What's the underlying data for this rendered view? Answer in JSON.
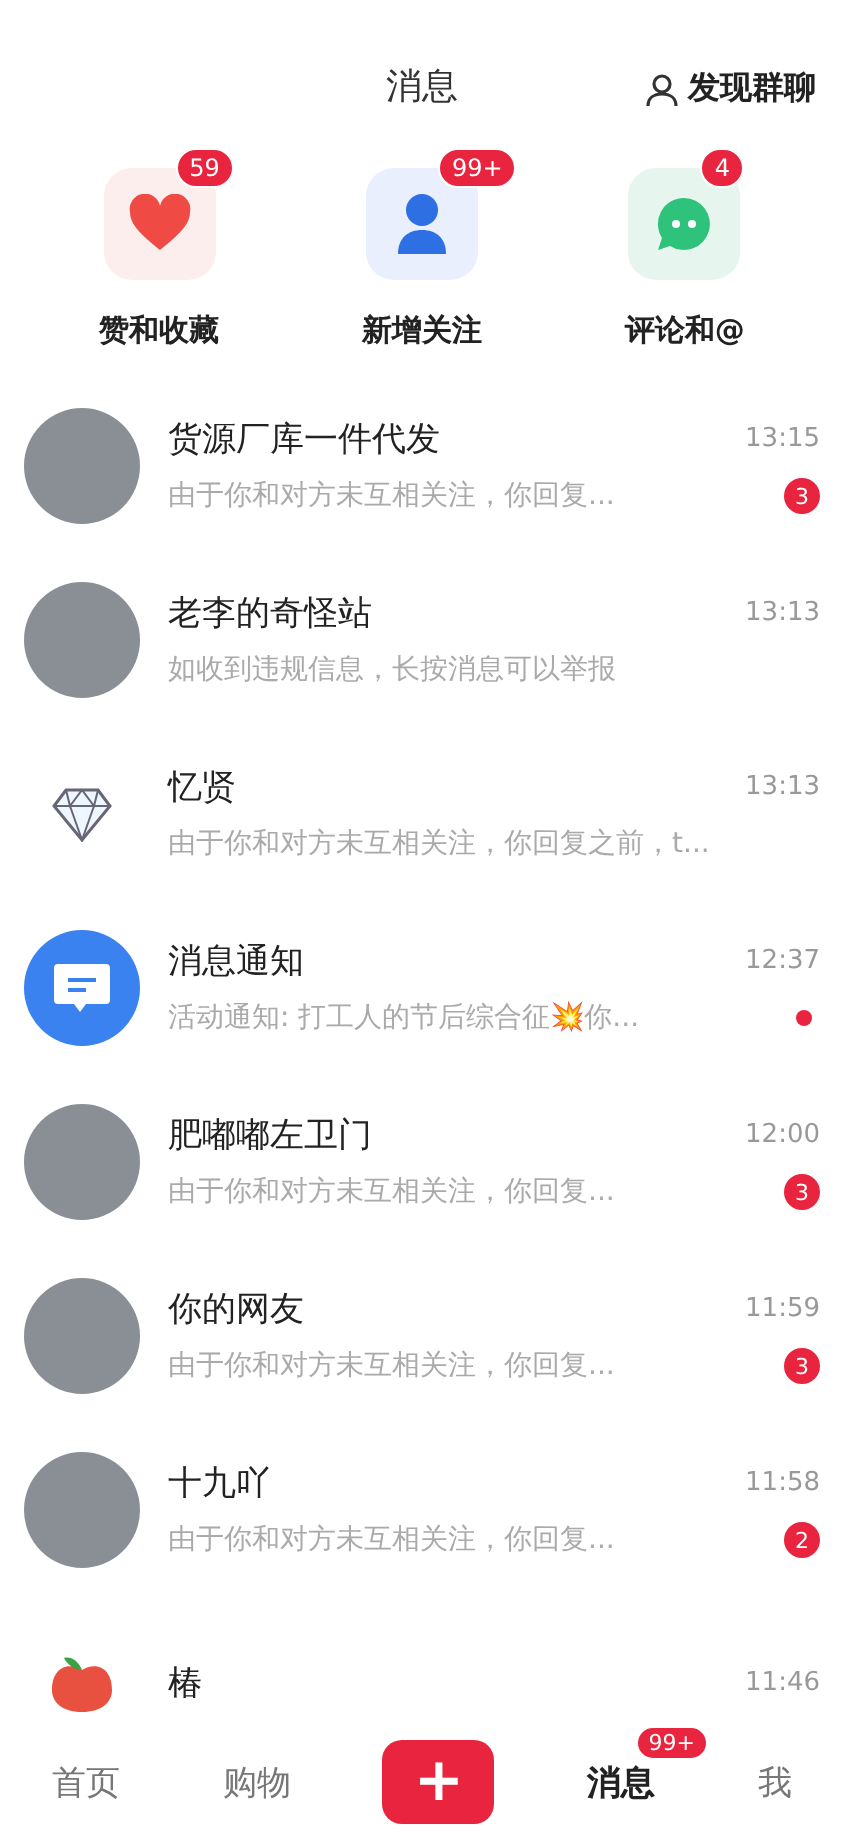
{
  "header": {
    "title": "消息",
    "action": "发现群聊"
  },
  "categories": [
    {
      "label": "赞和收藏",
      "badge": "59",
      "kind": "likes"
    },
    {
      "label": "新增关注",
      "badge": "99+",
      "kind": "follows"
    },
    {
      "label": "评论和@",
      "badge": "4",
      "kind": "comments"
    }
  ],
  "conversations": [
    {
      "name": "货源厂库一件代发",
      "preview": "由于你和对方未互相关注，你回复...",
      "time": "13:15",
      "avatar": {
        "kind": "photo"
      },
      "unread": {
        "kind": "count",
        "count": "3"
      }
    },
    {
      "name": "老李的奇怪站",
      "preview": "如收到违规信息，长按消息可以举报",
      "time": "13:13",
      "avatar": {
        "kind": "photo"
      }
    },
    {
      "name": "忆贤",
      "preview": "由于你和对方未互相关注，你回复之前，t...",
      "time": "13:13",
      "avatar": {
        "kind": "diamond"
      }
    },
    {
      "name": "消息通知",
      "preview": "活动通知: 打工人的节后综合征💥你...",
      "time": "12:37",
      "avatar": {
        "kind": "notice"
      },
      "unread": {
        "kind": "dot"
      }
    },
    {
      "name": "肥嘟嘟左卫门",
      "preview": "由于你和对方未互相关注，你回复...",
      "time": "12:00",
      "avatar": {
        "kind": "photo"
      },
      "unread": {
        "kind": "count",
        "count": "3"
      }
    },
    {
      "name": "你的网友",
      "preview": "由于你和对方未互相关注，你回复...",
      "time": "11:59",
      "avatar": {
        "kind": "photo"
      },
      "unread": {
        "kind": "count",
        "count": "3"
      }
    },
    {
      "name": "十九吖",
      "preview": "由于你和对方未互相关注，你回复...",
      "time": "11:58",
      "avatar": {
        "kind": "photo"
      },
      "unread": {
        "kind": "count",
        "count": "2"
      }
    },
    {
      "name": "椿",
      "time": "11:46",
      "avatar": {
        "kind": "apple"
      }
    }
  ],
  "tab_bar": [
    {
      "kind": "tab",
      "label": "首页",
      "selected": false
    },
    {
      "kind": "tab",
      "label": "购物",
      "selected": false
    },
    {
      "kind": "plus",
      "label": "+"
    },
    {
      "kind": "tab",
      "label": "消息",
      "selected": true,
      "badge": "99+"
    },
    {
      "kind": "tab",
      "label": "我",
      "selected": false
    }
  ]
}
